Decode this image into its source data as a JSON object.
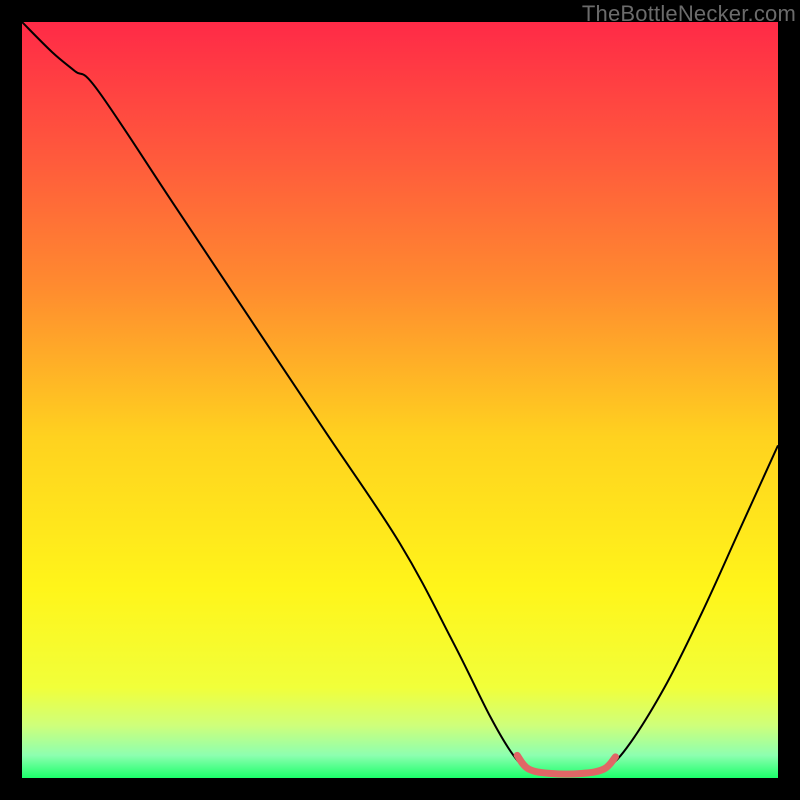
{
  "watermark": "TheBottleNecker.com",
  "chart_data": {
    "type": "line",
    "title": "",
    "xlabel": "",
    "ylabel": "",
    "xlim": [
      0,
      100
    ],
    "ylim": [
      0,
      100
    ],
    "background_gradient": {
      "stops": [
        {
          "pct": 0,
          "color": "#ff2a47"
        },
        {
          "pct": 18,
          "color": "#ff5a3c"
        },
        {
          "pct": 35,
          "color": "#ff8b2f"
        },
        {
          "pct": 55,
          "color": "#ffd21f"
        },
        {
          "pct": 75,
          "color": "#fff51a"
        },
        {
          "pct": 88,
          "color": "#f1ff3a"
        },
        {
          "pct": 93,
          "color": "#cfff7a"
        },
        {
          "pct": 97,
          "color": "#8dffb0"
        },
        {
          "pct": 100,
          "color": "#1cff6a"
        }
      ]
    },
    "series": [
      {
        "name": "bottleneck-curve",
        "stroke": "#000000",
        "stroke_width": 2,
        "points": [
          {
            "x": 0,
            "y": 100
          },
          {
            "x": 4,
            "y": 96
          },
          {
            "x": 7,
            "y": 93.5
          },
          {
            "x": 10,
            "y": 91
          },
          {
            "x": 20,
            "y": 76
          },
          {
            "x": 30,
            "y": 61
          },
          {
            "x": 40,
            "y": 46
          },
          {
            "x": 50,
            "y": 31
          },
          {
            "x": 57,
            "y": 18
          },
          {
            "x": 62,
            "y": 8
          },
          {
            "x": 65,
            "y": 3
          },
          {
            "x": 67,
            "y": 1.2
          },
          {
            "x": 70,
            "y": 0.5
          },
          {
            "x": 74,
            "y": 0.5
          },
          {
            "x": 77,
            "y": 1.2
          },
          {
            "x": 80,
            "y": 4
          },
          {
            "x": 85,
            "y": 12
          },
          {
            "x": 90,
            "y": 22
          },
          {
            "x": 95,
            "y": 33
          },
          {
            "x": 100,
            "y": 44
          }
        ]
      },
      {
        "name": "optimal-zone-marker",
        "stroke": "#e06666",
        "stroke_width": 7,
        "points": [
          {
            "x": 65.5,
            "y": 3.0
          },
          {
            "x": 67,
            "y": 1.2
          },
          {
            "x": 70,
            "y": 0.6
          },
          {
            "x": 74,
            "y": 0.6
          },
          {
            "x": 77,
            "y": 1.2
          },
          {
            "x": 78.5,
            "y": 2.8
          }
        ]
      }
    ]
  }
}
